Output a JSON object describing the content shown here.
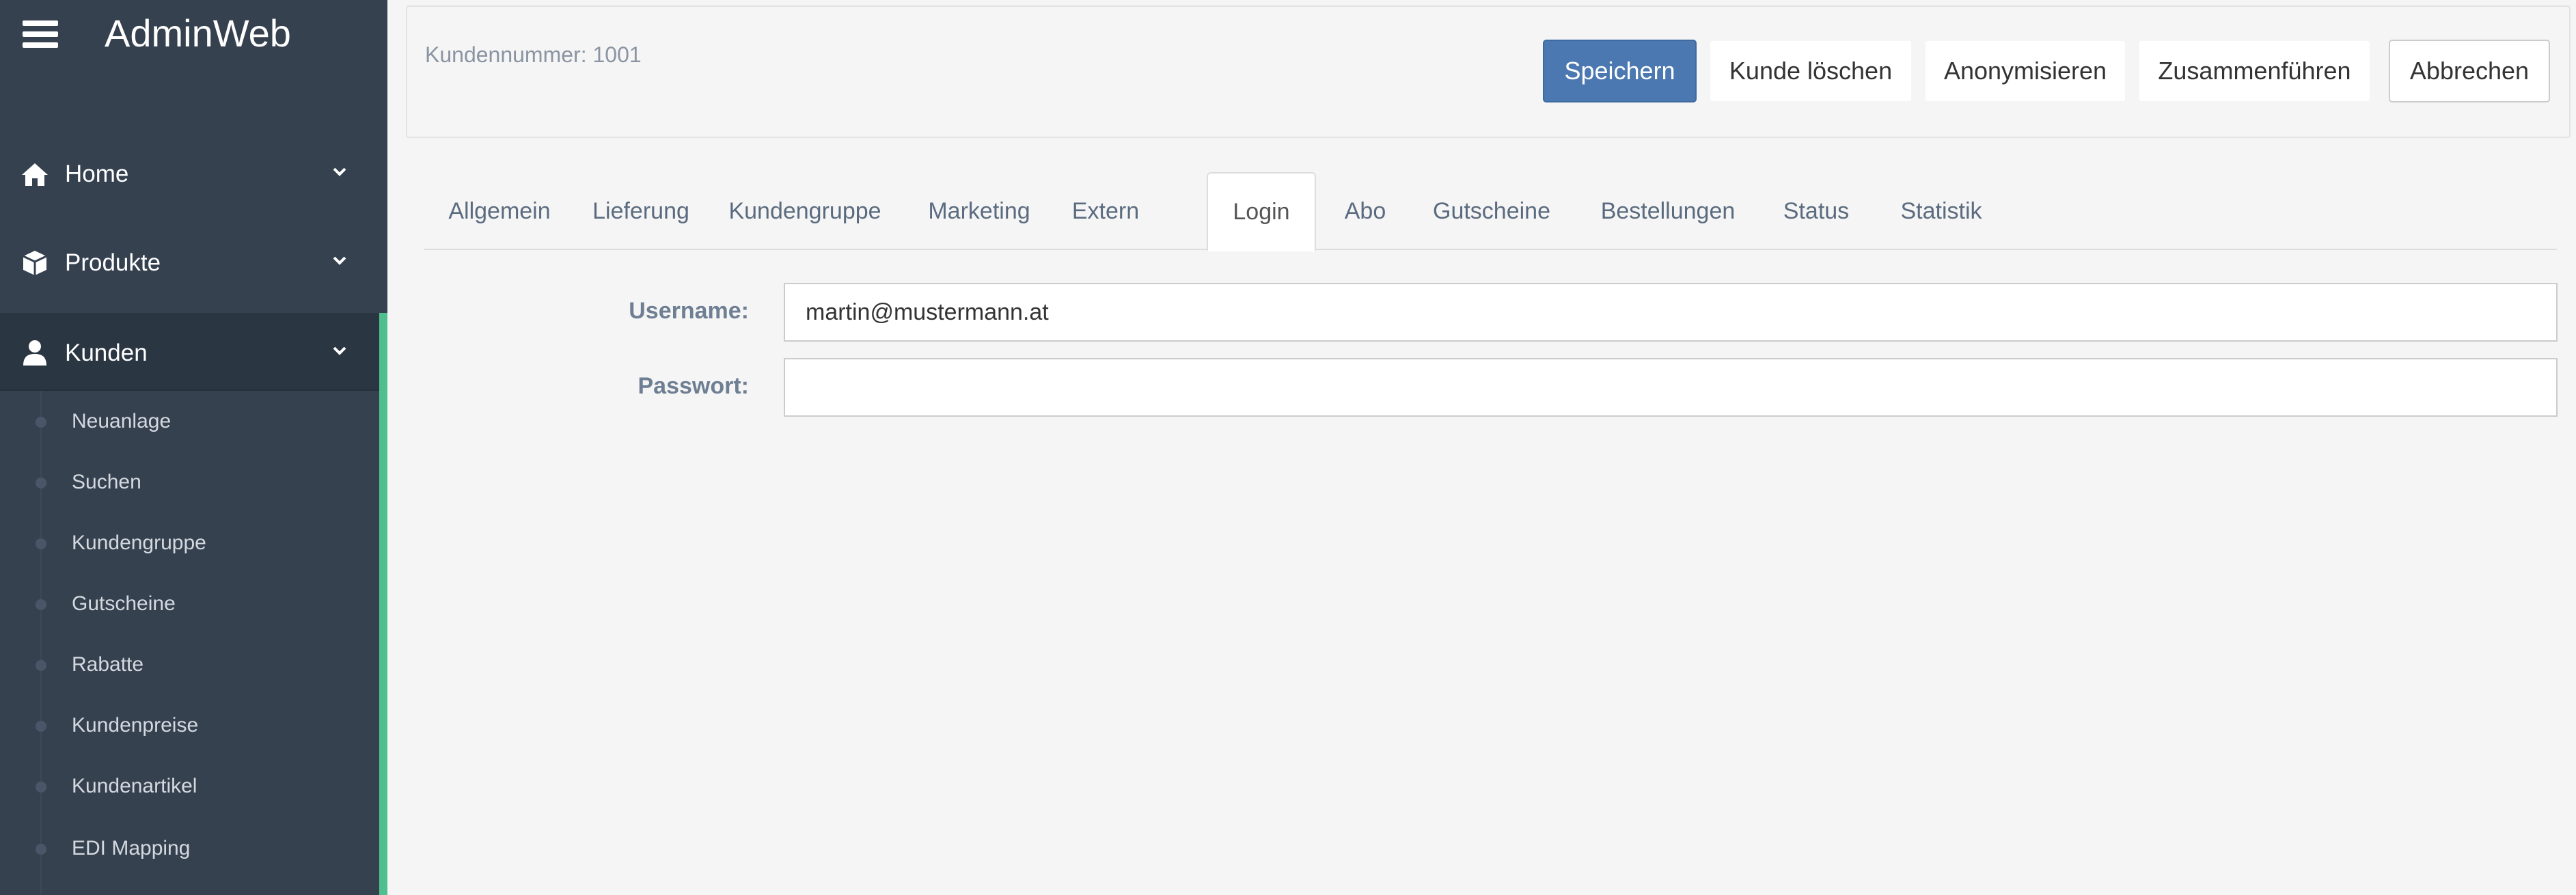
{
  "app": {
    "title": "AdminWeb"
  },
  "sidebar": {
    "items": [
      {
        "label": "Home",
        "icon": "home-icon"
      },
      {
        "label": "Produkte",
        "icon": "box-icon"
      },
      {
        "label": "Kunden",
        "icon": "user-icon",
        "active": true
      }
    ],
    "sub_items": [
      {
        "label": "Neuanlage"
      },
      {
        "label": "Suchen"
      },
      {
        "label": "Kundengruppe"
      },
      {
        "label": "Gutscheine"
      },
      {
        "label": "Rabatte"
      },
      {
        "label": "Kundenpreise"
      },
      {
        "label": "Kundenartikel"
      },
      {
        "label": "EDI Mapping"
      }
    ],
    "accent_color": "#4fc08d"
  },
  "header": {
    "customer_number": "Kundennummer: 1001",
    "buttons": {
      "save": "Speichern",
      "delete": "Kunde löschen",
      "anonymize": "Anonymisieren",
      "merge": "Zusammenführen",
      "cancel": "Abbrechen"
    },
    "primary_color": "#4b78b0"
  },
  "tabs": [
    {
      "label": "Allgemein"
    },
    {
      "label": "Lieferung"
    },
    {
      "label": "Kundengruppe"
    },
    {
      "label": "Marketing"
    },
    {
      "label": "Extern"
    },
    {
      "label": "Login",
      "active": true
    },
    {
      "label": "Abo"
    },
    {
      "label": "Gutscheine"
    },
    {
      "label": "Bestellungen"
    },
    {
      "label": "Status"
    },
    {
      "label": "Statistik"
    }
  ],
  "form": {
    "username_label": "Username:",
    "username_value": "martin@mustermann.at",
    "password_label": "Passwort:",
    "password_value": ""
  }
}
